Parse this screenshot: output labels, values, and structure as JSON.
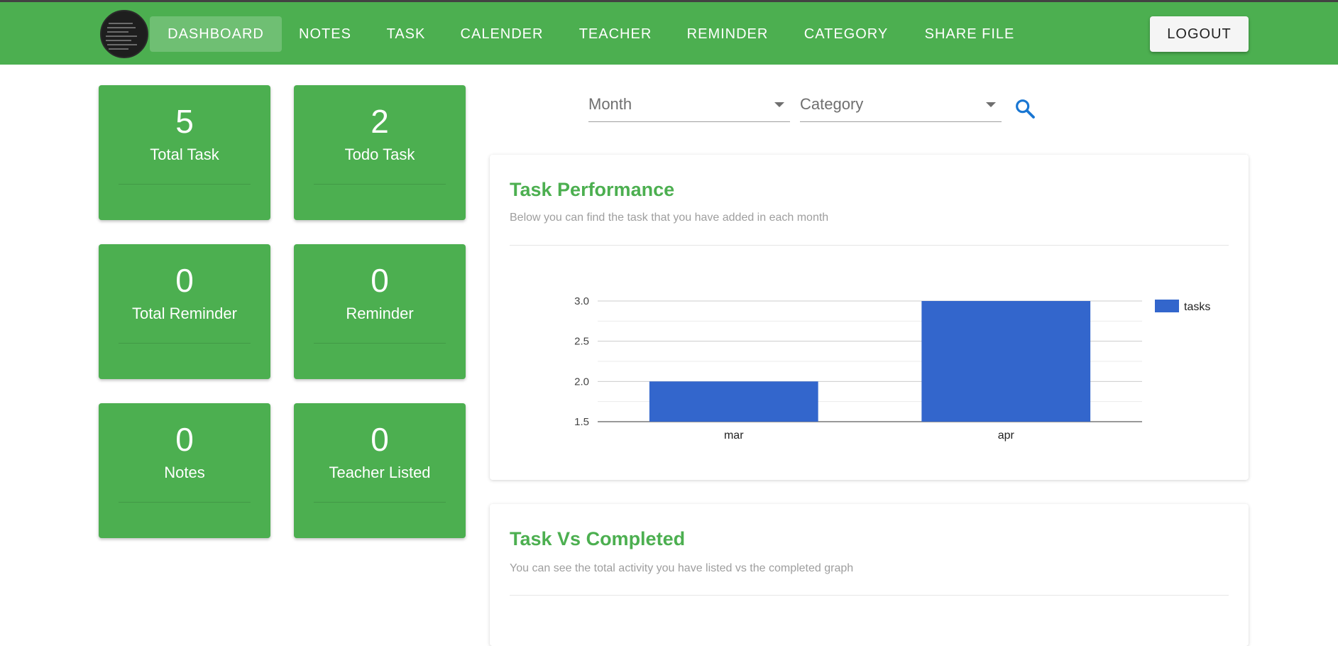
{
  "nav": {
    "items": [
      {
        "label": "DASHBOARD",
        "active": true
      },
      {
        "label": "NOTES"
      },
      {
        "label": "TASK"
      },
      {
        "label": "CALENDER"
      },
      {
        "label": "TEACHER"
      },
      {
        "label": "REMINDER"
      },
      {
        "label": "CATEGORY"
      },
      {
        "label": "SHARE FILE"
      }
    ],
    "logout_label": "LOGOUT"
  },
  "stats": [
    {
      "value": "5",
      "label": "Total Task"
    },
    {
      "value": "2",
      "label": "Todo Task"
    },
    {
      "value": "0",
      "label": "Total Reminder"
    },
    {
      "value": "0",
      "label": "Reminder"
    },
    {
      "value": "0",
      "label": "Notes"
    },
    {
      "value": "0",
      "label": "Teacher Listed"
    }
  ],
  "filters": {
    "month_placeholder": "Month",
    "category_placeholder": "Category"
  },
  "performance": {
    "title": "Task Performance",
    "subtitle": "Below you can find the task that you have added in each month"
  },
  "completed": {
    "title": "Task Vs Completed",
    "subtitle": "You can see the total activity you have listed vs the completed graph"
  },
  "colors": {
    "brand": "#4caf50",
    "bar": "#3366cc"
  },
  "chart_data": {
    "type": "bar",
    "categories": [
      "mar",
      "apr"
    ],
    "series": [
      {
        "name": "tasks",
        "values": [
          2,
          3
        ]
      }
    ],
    "ylim": [
      1.5,
      3.0
    ],
    "yticks": [
      "3.0",
      "2.5",
      "2.0",
      "1.5"
    ],
    "grid": true,
    "legend": "right"
  }
}
